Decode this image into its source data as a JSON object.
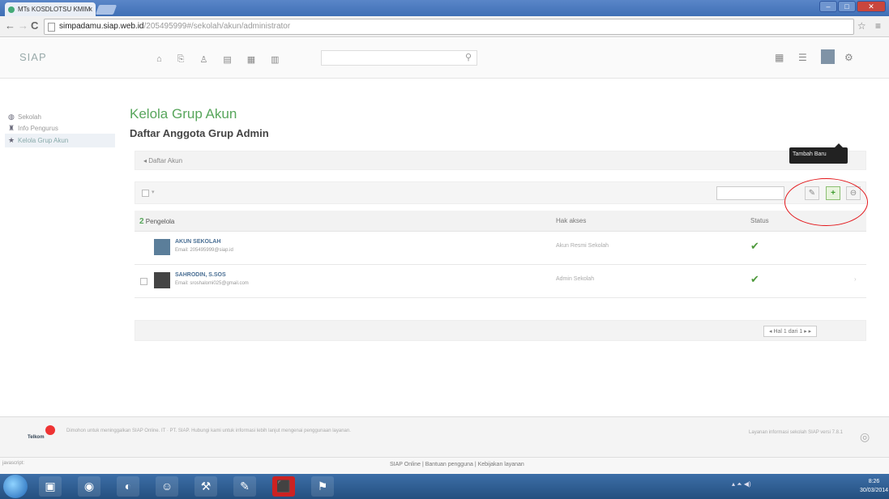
{
  "browser": {
    "tab_title": "MTs KOSDLOTSU KMIM",
    "tab_close": "x",
    "url_host": "simpadamu.siap.web.id",
    "url_path": "/205495999#/sekolah/akun/administrator",
    "nav_back": "←",
    "nav_forward": "→",
    "nav_reload": "C",
    "toolbar_icons": "☆ ≡"
  },
  "app": {
    "logo": "SIAP",
    "top_icons": [
      "⌂",
      "⎘",
      "♙",
      "▤",
      "▦",
      "▥"
    ],
    "search_icon": "⚲",
    "right_icons": [
      "▦",
      "☰",
      "⚙"
    ]
  },
  "sidebar": {
    "items": [
      {
        "icon": "◍",
        "label": "Sekolah"
      },
      {
        "icon": "♜",
        "label": "Info Pengurus"
      },
      {
        "icon": "★",
        "label": "Kelola Grup Akun"
      }
    ]
  },
  "main": {
    "title": "Kelola Grup Akun",
    "subtitle": "Daftar Anggota Grup Admin",
    "breadcrumb": "◂  Daftar Akun",
    "tooltip": "Tambah Baru",
    "buttons": {
      "edit": "✎",
      "add": "+",
      "delete": "⊖"
    },
    "table": {
      "headers": {
        "count": "2",
        "member": "Pengelola",
        "rights": "Hak akses",
        "status": "Status"
      },
      "rows": [
        {
          "name": "AKUN SEKOLAH",
          "email": "Email: 205495999@siap.id",
          "rights": "Akun Resmi Sekolah",
          "status": "✔"
        },
        {
          "name": "SAHRODIN, S.SOS",
          "email": "Email: sroshalomi025@gmail.com",
          "rights": "Admin Sekolah",
          "status": "✔"
        }
      ],
      "row_more": "›"
    },
    "pager": "◂  Hal 1 dari 1 ▸  ▸"
  },
  "footer": {
    "logo_text": "Telkom",
    "left_text": "Dimohon untuk meninggalkan SIAP Online. IT · PT. SIAP. Hubungi kami untuk informasi lebih lanjut mengenai penggunaan layanan.",
    "right_text": "Layanan informasi sekolah SIAP versi 7.8.1",
    "status_link": "javascript:",
    "links": "SIAP Online | Bantuan pengguna | Kebijakan layanan"
  },
  "taskbar": {
    "apps": [
      "▣",
      "◉",
      "◐",
      "☺",
      "⚒",
      "✎",
      "⬛",
      "⚑"
    ],
    "tray": "▴ ⏶ ◀)",
    "time": "8:26",
    "date": "30/03/2014"
  }
}
